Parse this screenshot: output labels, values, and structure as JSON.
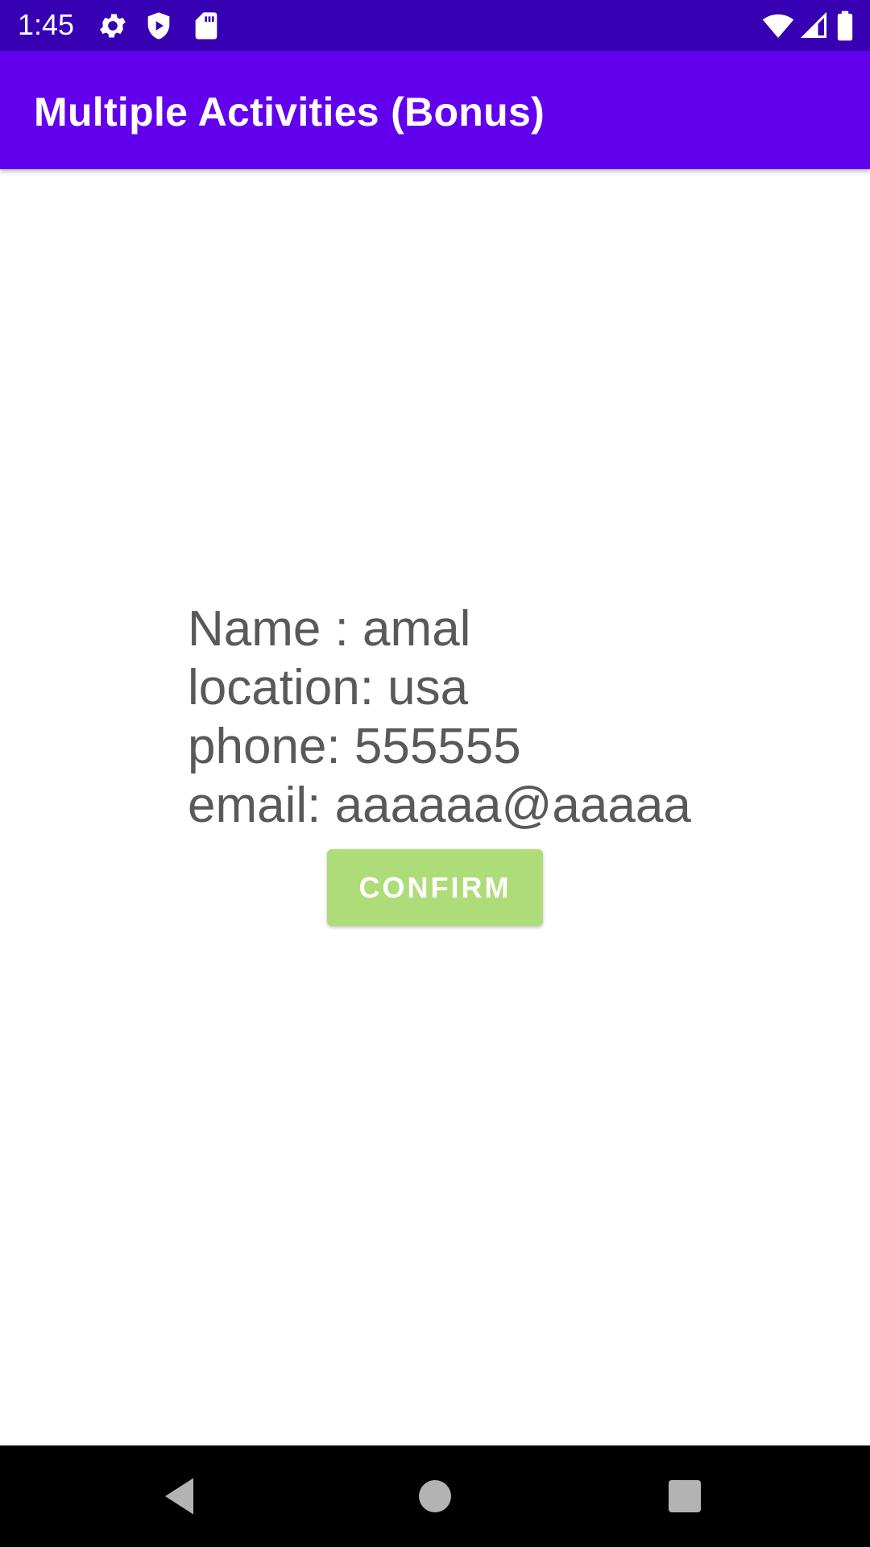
{
  "status_bar": {
    "time": "1:45",
    "background": "#3700B3",
    "left_icons": [
      "gear-icon",
      "shield-play-icon",
      "sd-card-icon"
    ],
    "right_icons": [
      "wifi-icon",
      "cellular-signal-icon",
      "battery-icon"
    ]
  },
  "app_bar": {
    "title": "Multiple Activities (Bonus)",
    "background": "#6200EE"
  },
  "details": {
    "name_line": "Name : amal",
    "location_line": "location: usa",
    "phone_line": "phone: 555555",
    "email_line": "email: aaaaaa@aaaaa",
    "text_color": "#595959"
  },
  "confirm_button": {
    "label": "CONFIRM",
    "background": "#ADDC78",
    "state": "disabled"
  },
  "nav_bar": {
    "buttons": [
      "back-icon",
      "home-icon",
      "recents-icon"
    ],
    "background": "#000000"
  }
}
